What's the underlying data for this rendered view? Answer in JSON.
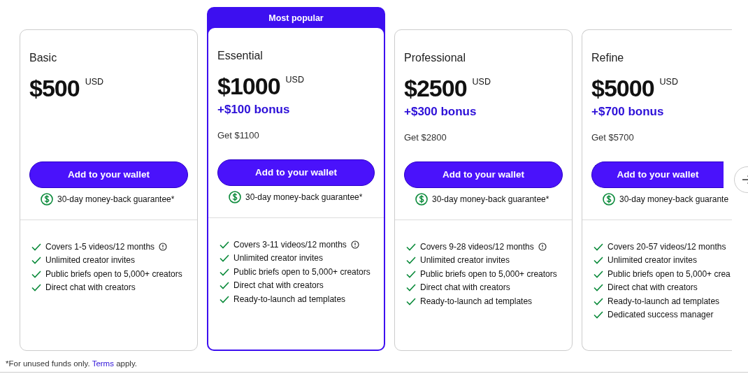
{
  "plans": [
    {
      "name": "Basic",
      "price": "$500",
      "currency": "USD",
      "popular": false,
      "cut": false,
      "button": "Add to your wallet",
      "guarantee": "30-day money-back guarantee*",
      "features": [
        {
          "text": "Covers 1-5 videos/12 months",
          "info": true
        },
        {
          "text": "Unlimited creator invites",
          "info": false
        },
        {
          "text": "Public briefs open to 5,000+ creators",
          "info": false
        },
        {
          "text": "Direct chat with creators",
          "info": false
        }
      ]
    },
    {
      "name": "Essential",
      "price": "$1000",
      "currency": "USD",
      "bonus": "+$100 bonus",
      "get": "Get $1100",
      "popular": true,
      "badge": "Most popular",
      "cut": false,
      "button": "Add to your wallet",
      "guarantee": "30-day money-back guarantee*",
      "features": [
        {
          "text": "Covers 3-11 videos/12 months",
          "info": true
        },
        {
          "text": "Unlimited creator invites",
          "info": false
        },
        {
          "text": "Public briefs open to 5,000+ creators",
          "info": false
        },
        {
          "text": "Direct chat with creators",
          "info": false
        },
        {
          "text": "Ready-to-launch ad templates",
          "info": false
        }
      ]
    },
    {
      "name": "Professional",
      "price": "$2500",
      "currency": "USD",
      "bonus": "+$300 bonus",
      "get": "Get $2800",
      "popular": false,
      "cut": false,
      "button": "Add to your wallet",
      "guarantee": "30-day money-back guarantee*",
      "features": [
        {
          "text": "Covers 9-28 videos/12 months",
          "info": true
        },
        {
          "text": "Unlimited creator invites",
          "info": false
        },
        {
          "text": "Public briefs open to 5,000+ creators",
          "info": false
        },
        {
          "text": "Direct chat with creators",
          "info": false
        },
        {
          "text": "Ready-to-launch ad templates",
          "info": false
        }
      ]
    },
    {
      "name": "Refine",
      "price": "$5000",
      "currency": "USD",
      "bonus": "+$700 bonus",
      "get": "Get $5700",
      "popular": false,
      "cut": true,
      "button": "Add to your wallet",
      "guarantee": "30-day money-back guarante",
      "features": [
        {
          "text": "Covers 20-57 videos/12 months",
          "info": false
        },
        {
          "text": "Unlimited creator invites",
          "info": false
        },
        {
          "text": "Public briefs open to 5,000+ crea",
          "info": false
        },
        {
          "text": "Direct chat with creators",
          "info": false
        },
        {
          "text": "Ready-to-launch ad templates",
          "info": false
        },
        {
          "text": "Dedicated success manager",
          "info": false
        }
      ]
    }
  ],
  "footnote": {
    "before": "*For unused funds only.",
    "link": "Terms",
    "after": "apply."
  }
}
